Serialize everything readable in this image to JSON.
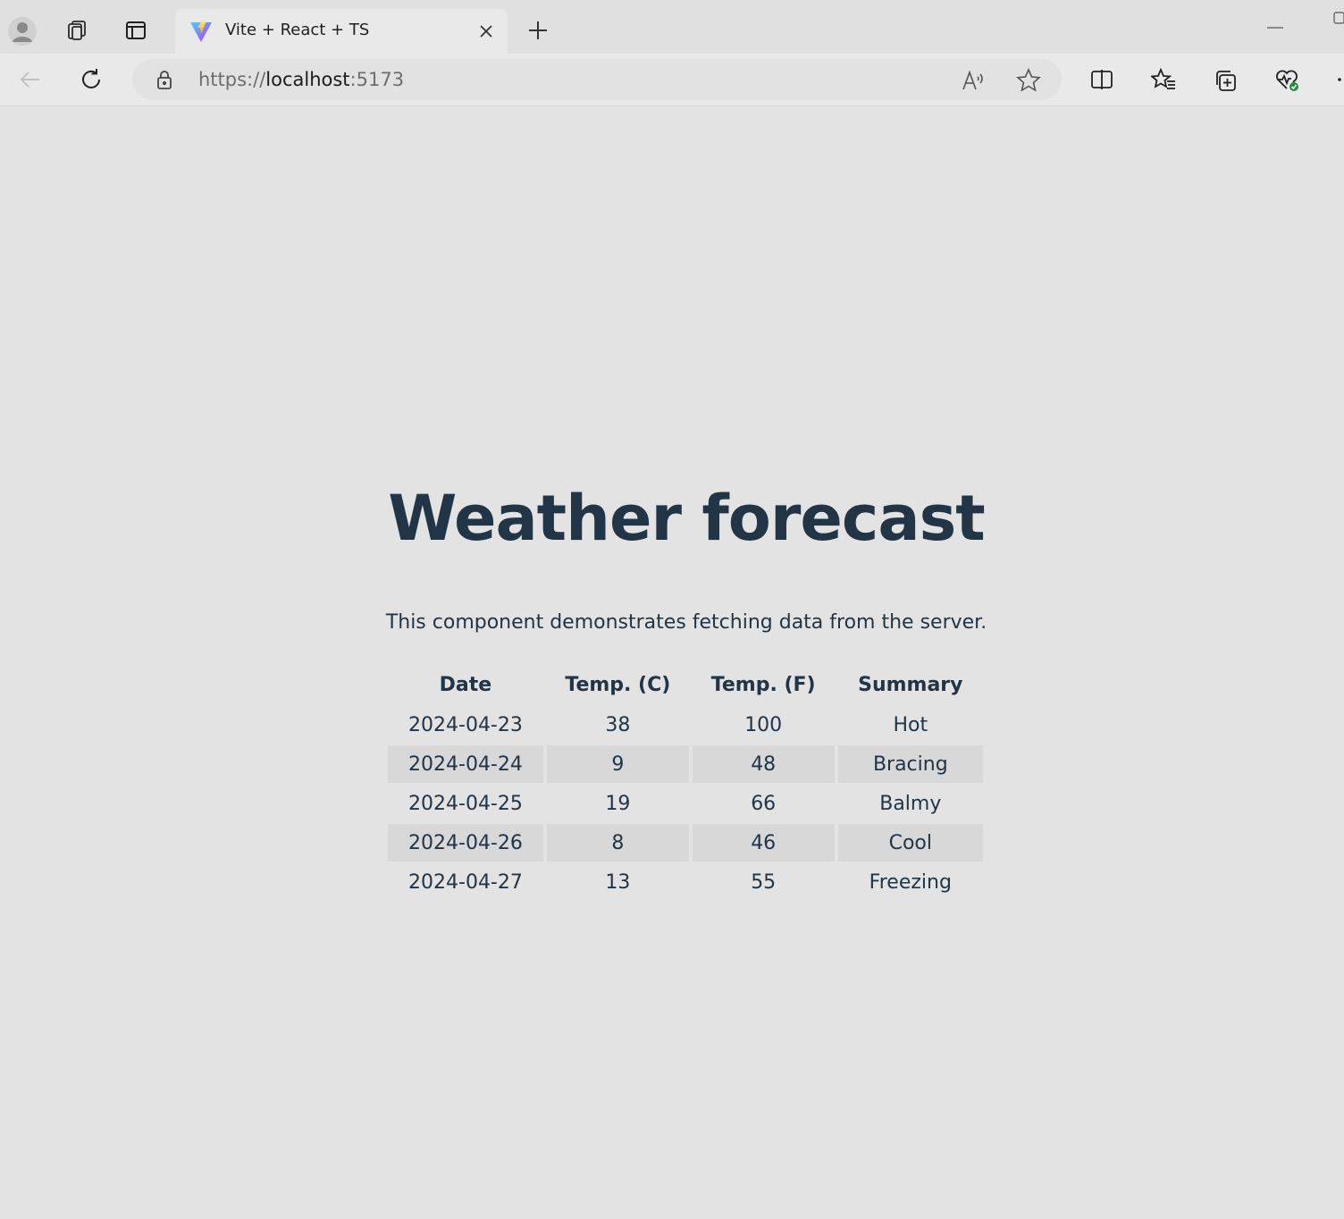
{
  "browser": {
    "tab": {
      "title": "Vite + React + TS",
      "favicon": "vite-logo-icon"
    },
    "address_bar": {
      "scheme": "https://",
      "host": "localhost",
      "port": ":5173"
    },
    "icons": {
      "profile": "profile-avatar-icon",
      "workspaces": "workspaces-icon",
      "tab_actions": "tab-actions-icon",
      "close_tab": "close-icon",
      "new_tab": "plus-icon",
      "back": "arrow-left-icon",
      "refresh": "refresh-icon",
      "lock": "lock-icon",
      "read_aloud": "read-aloud-icon",
      "favorite": "star-icon",
      "split_screen": "split-screen-icon",
      "favorites": "favorites-icon",
      "collections": "collections-icon",
      "browser_essentials": "heart-pulse-icon"
    }
  },
  "page": {
    "title": "Weather forecast",
    "intro": "This component demonstrates fetching data from the server.",
    "table": {
      "headers": [
        "Date",
        "Temp. (C)",
        "Temp. (F)",
        "Summary"
      ],
      "rows": [
        [
          "2024-04-23",
          "38",
          "100",
          "Hot"
        ],
        [
          "2024-04-24",
          "9",
          "48",
          "Bracing"
        ],
        [
          "2024-04-25",
          "19",
          "66",
          "Balmy"
        ],
        [
          "2024-04-26",
          "8",
          "46",
          "Cool"
        ],
        [
          "2024-04-27",
          "13",
          "55",
          "Freezing"
        ]
      ]
    }
  },
  "colors": {
    "text": "#213547",
    "background": "#e3e3e3",
    "stripe": "#d8d8d8"
  }
}
